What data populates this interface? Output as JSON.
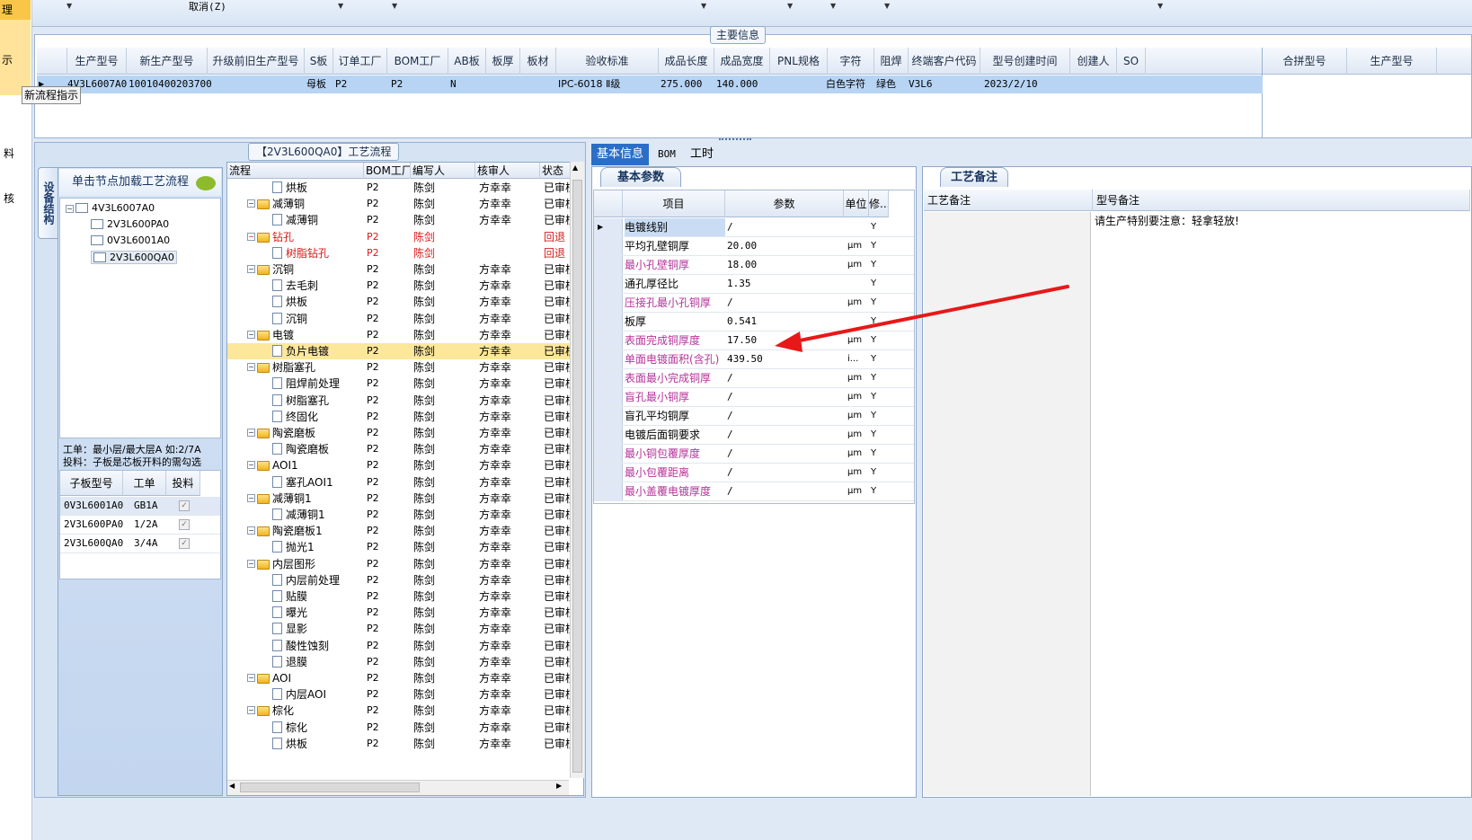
{
  "left_strip": {
    "items": [
      "理",
      "示",
      "料",
      "核"
    ]
  },
  "toolbar": {
    "cancel_label": "取消(Z)"
  },
  "main_info": {
    "title": "主要信息",
    "columns": [
      "生产型号",
      "新生产型号",
      "升级前旧生产型号",
      "S板",
      "订单工厂",
      "BOM工厂",
      "AB板",
      "板厚",
      "板材",
      "验收标准",
      "成品长度",
      "成品宽度",
      "PNL规格",
      "字符",
      "阻焊",
      "终端客户代码",
      "型号创建时间",
      "创建人",
      "SO"
    ],
    "right_columns": [
      "合拼型号",
      "生产型号"
    ],
    "row": {
      "prod_model": "4V3L6007A0",
      "new_model": "10010400203700",
      "s_board": "母板",
      "order_factory": "P2",
      "bom_factory": "P2",
      "ab_board": "N",
      "standard": "IPC-6018 Ⅱ级",
      "length": "275.000",
      "width": "140.000",
      "char": "白色字符",
      "mask": "绿色",
      "customer": "V3L6",
      "created": "2023/2/10"
    },
    "tooltip": "新流程指示"
  },
  "process": {
    "title": "【2V3L600QA0】工艺流程",
    "side_tab": "设备结构",
    "struct_head": "单击节点加载工艺流程",
    "tree": [
      "4V3L6007A0",
      "2V3L600PA0",
      "0V3L6001A0",
      "2V3L600QA0"
    ],
    "info_line1": "工单：最小层/最大层A 如:2/7A",
    "info_line2": "投料：子板是芯板开料的需勾选",
    "sub_columns": [
      "子板型号",
      "工单",
      "投料"
    ],
    "sub_rows": [
      {
        "model": "0V3L6001A0",
        "order": "GB1A"
      },
      {
        "model": "2V3L600PA0",
        "order": "1/2A"
      },
      {
        "model": "2V3L600QA0",
        "order": "3/4A"
      }
    ],
    "flow_columns": [
      "流程",
      "BOM工厂",
      "编写人",
      "核审人",
      "状态"
    ],
    "flow_rows": [
      {
        "name": "烘板",
        "level": 2,
        "type": "doc",
        "bom": "P2",
        "writer": "陈剑",
        "reviewer": "方幸幸",
        "status": "已审核"
      },
      {
        "name": "减薄铜",
        "level": 1,
        "type": "folder",
        "bom": "P2",
        "writer": "陈剑",
        "reviewer": "方幸幸",
        "status": "已审核"
      },
      {
        "name": "减薄铜",
        "level": 2,
        "type": "doc",
        "bom": "P2",
        "writer": "陈剑",
        "reviewer": "方幸幸",
        "status": "已审核"
      },
      {
        "name": "钻孔",
        "level": 1,
        "type": "folder",
        "bom": "P2",
        "writer": "陈剑",
        "reviewer": "",
        "status": "回退",
        "red": true
      },
      {
        "name": "树脂钻孔",
        "level": 2,
        "type": "doc",
        "bom": "P2",
        "writer": "陈剑",
        "reviewer": "",
        "status": "回退",
        "red": true
      },
      {
        "name": "沉铜",
        "level": 1,
        "type": "folder",
        "bom": "P2",
        "writer": "陈剑",
        "reviewer": "方幸幸",
        "status": "已审核"
      },
      {
        "name": "去毛刺",
        "level": 2,
        "type": "doc",
        "bom": "P2",
        "writer": "陈剑",
        "reviewer": "方幸幸",
        "status": "已审核"
      },
      {
        "name": "烘板",
        "level": 2,
        "type": "doc",
        "bom": "P2",
        "writer": "陈剑",
        "reviewer": "方幸幸",
        "status": "已审核"
      },
      {
        "name": "沉铜",
        "level": 2,
        "type": "doc",
        "bom": "P2",
        "writer": "陈剑",
        "reviewer": "方幸幸",
        "status": "已审核"
      },
      {
        "name": "电镀",
        "level": 1,
        "type": "folder",
        "bom": "P2",
        "writer": "陈剑",
        "reviewer": "方幸幸",
        "status": "已审核"
      },
      {
        "name": "负片电镀",
        "level": 2,
        "type": "doc",
        "bom": "P2",
        "writer": "陈剑",
        "reviewer": "方幸幸",
        "status": "已审核",
        "highlight": true
      },
      {
        "name": "树脂塞孔",
        "level": 1,
        "type": "folder",
        "bom": "P2",
        "writer": "陈剑",
        "reviewer": "方幸幸",
        "status": "已审核"
      },
      {
        "name": "阻焊前处理",
        "level": 2,
        "type": "doc",
        "bom": "P2",
        "writer": "陈剑",
        "reviewer": "方幸幸",
        "status": "已审核"
      },
      {
        "name": "树脂塞孔",
        "level": 2,
        "type": "doc",
        "bom": "P2",
        "writer": "陈剑",
        "reviewer": "方幸幸",
        "status": "已审核"
      },
      {
        "name": "终固化",
        "level": 2,
        "type": "doc",
        "bom": "P2",
        "writer": "陈剑",
        "reviewer": "方幸幸",
        "status": "已审核"
      },
      {
        "name": "陶瓷磨板",
        "level": 1,
        "type": "folder",
        "bom": "P2",
        "writer": "陈剑",
        "reviewer": "方幸幸",
        "status": "已审核"
      },
      {
        "name": "陶瓷磨板",
        "level": 2,
        "type": "doc",
        "bom": "P2",
        "writer": "陈剑",
        "reviewer": "方幸幸",
        "status": "已审核"
      },
      {
        "name": "AOI1",
        "level": 1,
        "type": "folder",
        "bom": "P2",
        "writer": "陈剑",
        "reviewer": "方幸幸",
        "status": "已审核"
      },
      {
        "name": "塞孔AOI1",
        "level": 2,
        "type": "doc",
        "bom": "P2",
        "writer": "陈剑",
        "reviewer": "方幸幸",
        "status": "已审核"
      },
      {
        "name": "减薄铜1",
        "level": 1,
        "type": "folder",
        "bom": "P2",
        "writer": "陈剑",
        "reviewer": "方幸幸",
        "status": "已审核"
      },
      {
        "name": "减薄铜1",
        "level": 2,
        "type": "doc",
        "bom": "P2",
        "writer": "陈剑",
        "reviewer": "方幸幸",
        "status": "已审核"
      },
      {
        "name": "陶瓷磨板1",
        "level": 1,
        "type": "folder",
        "bom": "P2",
        "writer": "陈剑",
        "reviewer": "方幸幸",
        "status": "已审核"
      },
      {
        "name": "抛光1",
        "level": 2,
        "type": "doc",
        "bom": "P2",
        "writer": "陈剑",
        "reviewer": "方幸幸",
        "status": "已审核"
      },
      {
        "name": "内层图形",
        "level": 1,
        "type": "folder",
        "bom": "P2",
        "writer": "陈剑",
        "reviewer": "方幸幸",
        "status": "已审核"
      },
      {
        "name": "内层前处理",
        "level": 2,
        "type": "doc",
        "bom": "P2",
        "writer": "陈剑",
        "reviewer": "方幸幸",
        "status": "已审核"
      },
      {
        "name": "贴膜",
        "level": 2,
        "type": "doc",
        "bom": "P2",
        "writer": "陈剑",
        "reviewer": "方幸幸",
        "status": "已审核"
      },
      {
        "name": "曝光",
        "level": 2,
        "type": "doc",
        "bom": "P2",
        "writer": "陈剑",
        "reviewer": "方幸幸",
        "status": "已审核"
      },
      {
        "name": "显影",
        "level": 2,
        "type": "doc",
        "bom": "P2",
        "writer": "陈剑",
        "reviewer": "方幸幸",
        "status": "已审核"
      },
      {
        "name": "酸性蚀刻",
        "level": 2,
        "type": "doc",
        "bom": "P2",
        "writer": "陈剑",
        "reviewer": "方幸幸",
        "status": "已审核"
      },
      {
        "name": "退膜",
        "level": 2,
        "type": "doc",
        "bom": "P2",
        "writer": "陈剑",
        "reviewer": "方幸幸",
        "status": "已审核"
      },
      {
        "name": "AOI",
        "level": 1,
        "type": "folder",
        "bom": "P2",
        "writer": "陈剑",
        "reviewer": "方幸幸",
        "status": "已审核"
      },
      {
        "name": "内层AOI",
        "level": 2,
        "type": "doc",
        "bom": "P2",
        "writer": "陈剑",
        "reviewer": "方幸幸",
        "status": "已审核"
      },
      {
        "name": "棕化",
        "level": 1,
        "type": "folder",
        "bom": "P2",
        "writer": "陈剑",
        "reviewer": "方幸幸",
        "status": "已审核"
      },
      {
        "name": "棕化",
        "level": 2,
        "type": "doc",
        "bom": "P2",
        "writer": "陈剑",
        "reviewer": "方幸幸",
        "status": "已审核"
      },
      {
        "name": "烘板",
        "level": 2,
        "type": "doc",
        "bom": "P2",
        "writer": "陈剑",
        "reviewer": "方幸幸",
        "status": "已审核"
      }
    ]
  },
  "right": {
    "tabs": [
      "基本信息",
      "BOM",
      "工时"
    ],
    "basic_tab": "基本参数",
    "param_columns": [
      "项目",
      "参数",
      "单位",
      "修..."
    ],
    "params": [
      {
        "name": "电镀线别",
        "value": "/",
        "unit": "",
        "mod": "Y",
        "pink": false
      },
      {
        "name": "平均孔壁铜厚",
        "value": "20.00",
        "unit": "μm",
        "mod": "Y",
        "pink": false
      },
      {
        "name": "最小孔壁铜厚",
        "value": "18.00",
        "unit": "μm",
        "mod": "Y",
        "pink": true
      },
      {
        "name": "通孔厚径比",
        "value": "1.35",
        "unit": "",
        "mod": "Y",
        "pink": false
      },
      {
        "name": "压接孔最小孔铜厚",
        "value": "/",
        "unit": "μm",
        "mod": "Y",
        "pink": true
      },
      {
        "name": "板厚",
        "value": "0.541",
        "unit": "",
        "mod": "Y",
        "pink": false
      },
      {
        "name": "表面完成铜厚度",
        "value": "17.50",
        "unit": "μm",
        "mod": "Y",
        "pink": true
      },
      {
        "name": "单面电镀面积(含孔)",
        "value": "439.50",
        "unit": "i...",
        "mod": "Y",
        "pink": true
      },
      {
        "name": "表面最小完成铜厚",
        "value": "/",
        "unit": "μm",
        "mod": "Y",
        "pink": true
      },
      {
        "name": "盲孔最小铜厚",
        "value": "/",
        "unit": "μm",
        "mod": "Y",
        "pink": true
      },
      {
        "name": "盲孔平均铜厚",
        "value": "/",
        "unit": "μm",
        "mod": "Y",
        "pink": false
      },
      {
        "name": "电镀后面铜要求",
        "value": "/",
        "unit": "μm",
        "mod": "Y",
        "pink": false
      },
      {
        "name": "最小铜包覆厚度",
        "value": "/",
        "unit": "μm",
        "mod": "Y",
        "pink": true
      },
      {
        "name": "最小包覆距离",
        "value": "/",
        "unit": "μm",
        "mod": "Y",
        "pink": true
      },
      {
        "name": "最小盖覆电镀厚度",
        "value": "/",
        "unit": "μm",
        "mod": "Y",
        "pink": true
      }
    ],
    "notes_tab": "工艺备注",
    "notes_columns": [
      "工艺备注",
      "型号备注"
    ],
    "model_note": "请生产特别要注意：轻拿轻放!"
  }
}
